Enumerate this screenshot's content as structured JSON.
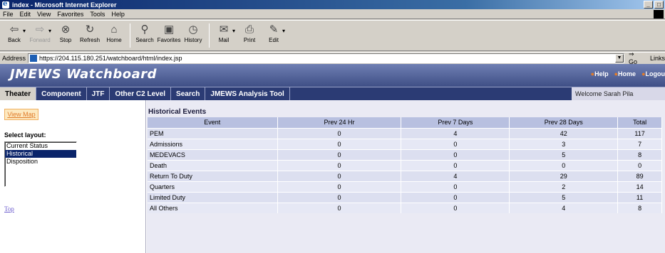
{
  "window": {
    "title": "index - Microsoft Internet Explorer"
  },
  "menu": [
    "File",
    "Edit",
    "View",
    "Favorites",
    "Tools",
    "Help"
  ],
  "toolbar": {
    "buttons": [
      {
        "label": "Back",
        "icon": "back-arrow-icon"
      },
      {
        "label": "Forward",
        "icon": "forward-arrow-icon"
      },
      {
        "label": "Stop",
        "icon": "stop-icon"
      },
      {
        "label": "Refresh",
        "icon": "refresh-icon"
      },
      {
        "label": "Home",
        "icon": "home-icon"
      },
      {
        "label": "Search",
        "icon": "search-icon"
      },
      {
        "label": "Favorites",
        "icon": "favorites-icon"
      },
      {
        "label": "History",
        "icon": "history-icon"
      },
      {
        "label": "Mail",
        "icon": "mail-icon"
      },
      {
        "label": "Print",
        "icon": "print-icon"
      },
      {
        "label": "Edit",
        "icon": "edit-icon"
      }
    ]
  },
  "address": {
    "label": "Address",
    "url": "https://204.115.180.251/watchboard/html/index.jsp",
    "go": "Go",
    "links": "Links"
  },
  "banner": {
    "brand": "JMEWS Watchboard",
    "links": [
      "Help",
      "Home",
      "Logou"
    ]
  },
  "nav": {
    "tabs": [
      "Theater",
      "Component",
      "JTF",
      "Other C2 Level",
      "Search",
      "JMEWS Analysis Tool"
    ],
    "active": "Theater",
    "welcome": "Welcome Sarah Pila"
  },
  "sidebar": {
    "view_map": "View Map",
    "select_label": "Select layout:",
    "layouts": [
      "Current Status",
      "Historical",
      "Disposition"
    ],
    "selected": "Historical",
    "top_link": "Top"
  },
  "panel": {
    "title": "Historical Events",
    "columns": [
      "Event",
      "Prev 24 Hr",
      "Prev 7 Days",
      "Prev 28 Days",
      "Total"
    ],
    "rows": [
      [
        "PEM",
        "0",
        "4",
        "42",
        "117"
      ],
      [
        "Admissions",
        "0",
        "0",
        "3",
        "7"
      ],
      [
        "MEDEVACS",
        "0",
        "0",
        "5",
        "8"
      ],
      [
        "Death",
        "0",
        "0",
        "0",
        "0"
      ],
      [
        "Return To Duty",
        "0",
        "4",
        "29",
        "89"
      ],
      [
        "Quarters",
        "0",
        "0",
        "2",
        "14"
      ],
      [
        "Limited Duty",
        "0",
        "0",
        "5",
        "11"
      ],
      [
        "All Others",
        "0",
        "0",
        "4",
        "8"
      ]
    ]
  }
}
